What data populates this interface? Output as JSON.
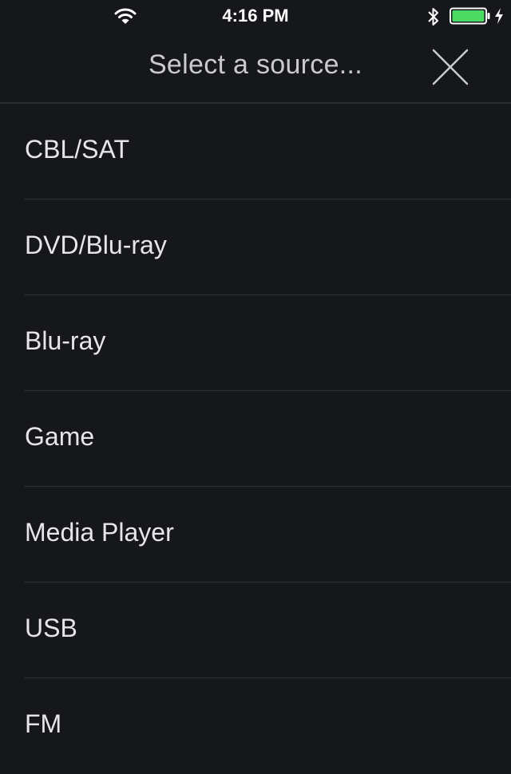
{
  "status_bar": {
    "time": "4:16 PM",
    "wifi_icon": "wifi-icon",
    "bluetooth_icon": "bluetooth-icon",
    "battery_icon": "battery-icon",
    "charging_icon": "charging-bolt-icon",
    "battery_level": 1.0,
    "battery_color": "#4cd964"
  },
  "header": {
    "title": "Select a source...",
    "close_icon": "close-icon"
  },
  "sources": [
    {
      "label": "CBL/SAT"
    },
    {
      "label": "DVD/Blu-ray"
    },
    {
      "label": "Blu-ray"
    },
    {
      "label": "Game"
    },
    {
      "label": "Media Player"
    },
    {
      "label": "USB"
    },
    {
      "label": "FM"
    }
  ],
  "colors": {
    "background": "#16171b",
    "text": "#e6e6e8",
    "title_text": "#c9cacd",
    "divider": "#2e2f34"
  }
}
